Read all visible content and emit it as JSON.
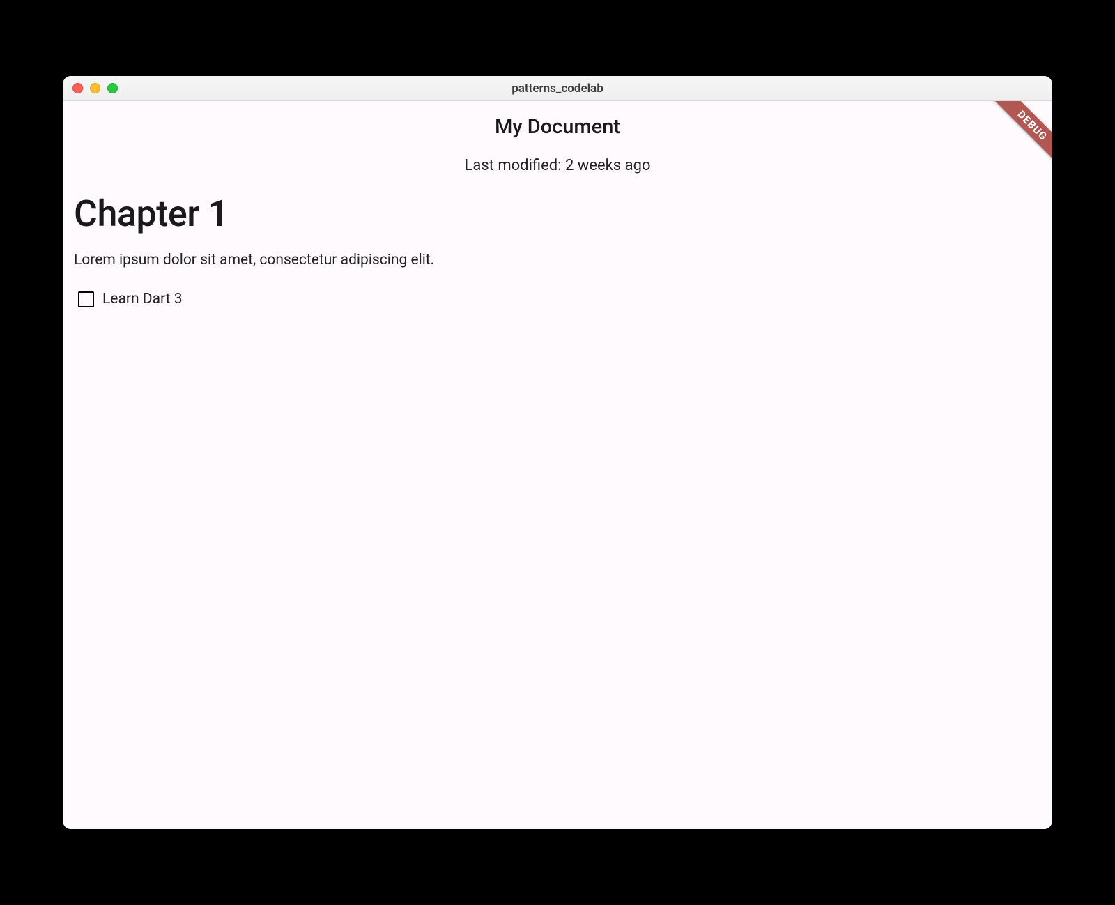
{
  "window": {
    "title": "patterns_codelab"
  },
  "debug_banner": "DEBUG",
  "appbar": {
    "title": "My Document"
  },
  "subtitle": "Last modified: 2 weeks ago",
  "blocks": {
    "heading": "Chapter 1",
    "paragraph": "Lorem ipsum dolor sit amet, consectetur adipiscing elit.",
    "checkbox": {
      "checked": false,
      "label": "Learn Dart 3"
    }
  }
}
